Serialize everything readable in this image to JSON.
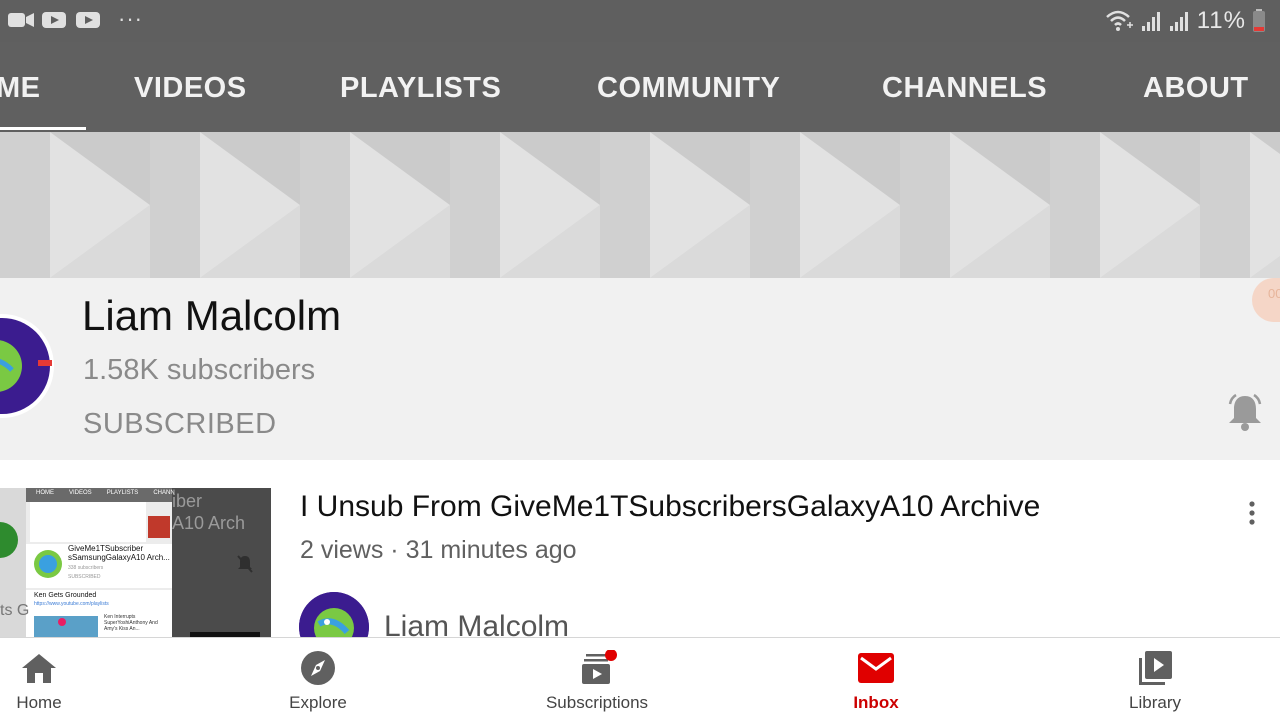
{
  "status_bar": {
    "battery_percent": "11%",
    "dots": "···"
  },
  "tabs": [
    {
      "label": "ME",
      "active": true
    },
    {
      "label": "VIDEOS"
    },
    {
      "label": "PLAYLISTS"
    },
    {
      "label": "COMMUNITY"
    },
    {
      "label": "CHANNELS"
    },
    {
      "label": "ABOUT"
    }
  ],
  "channel": {
    "name": "Liam Malcolm",
    "subscribers": "1.58K subscribers",
    "subscribe_state": "SUBSCRIBED",
    "fab_text": "00"
  },
  "video": {
    "title": "I Unsub From GiveMe1TSubscribersGalaxyA10 Archive",
    "meta": "2 views · 31 minutes ago",
    "channel_name": "Liam Malcolm",
    "thumbnail": {
      "tabs": [
        "HOME",
        "VIDEOS",
        "PLAYLISTS",
        "CHANN"
      ],
      "overlay_text_1": "iber",
      "overlay_text_2": "A10 Arch",
      "channel_title": "GiveMe1TSubscriber sSamsungGalaxyA10 Arch...",
      "subs": "338 subscribers",
      "subscribed": "SUBSCRIBED",
      "card_title": "Ken Gets Grounded",
      "card_url": "https://www.youtube.com/playlists",
      "card_video": "Ken Interrupts SuperYoshiAnthony And Amy's Kiss An...",
      "left_text": "ts G"
    }
  },
  "bottom_nav": [
    {
      "label": "Home",
      "icon": "home-icon"
    },
    {
      "label": "Explore",
      "icon": "compass-icon"
    },
    {
      "label": "Subscriptions",
      "icon": "subscriptions-icon"
    },
    {
      "label": "Inbox",
      "icon": "inbox-icon",
      "active": true
    },
    {
      "label": "Library",
      "icon": "library-icon"
    }
  ],
  "colors": {
    "accent": "#cc0000",
    "tab_bar": "#606060",
    "status_bar": "#5f5f5f"
  }
}
